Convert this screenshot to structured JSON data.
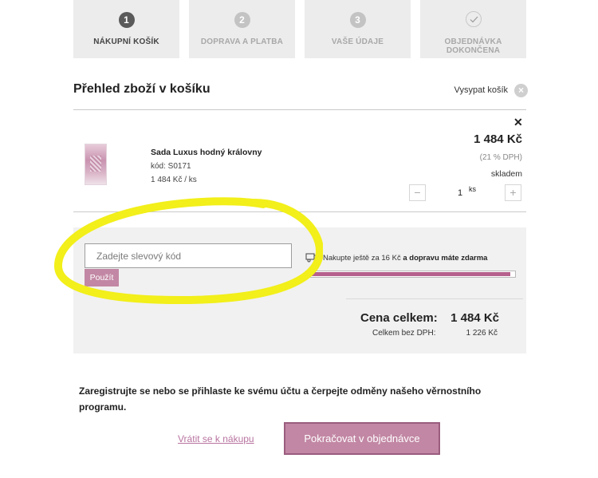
{
  "steps": [
    {
      "number": "1",
      "label": "NÁKUPNÍ KOŠÍK"
    },
    {
      "number": "2",
      "label": "DOPRAVA A PLATBA"
    },
    {
      "number": "3",
      "label": "VAŠE ÚDAJE"
    },
    {
      "label": "OBJEDNÁVKA DOKONČENA"
    }
  ],
  "cart": {
    "title": "Přehled zboží v košíku",
    "empty_label": "Vysypat košík"
  },
  "product": {
    "name": "Sada Luxus hodný královny",
    "code": "kód: S0171",
    "unit_price": "1 484 Kč / ks",
    "price": "1 484 Kč",
    "vat": "(21 % DPH)",
    "stock": "skladem",
    "quantity": "1",
    "unit": "ks"
  },
  "coupon": {
    "placeholder": "Zadejte slevový kód",
    "apply_label": "Použít"
  },
  "shipping": {
    "text_prefix": "Nakupte ještě za 16 Kč",
    "text_bold": "a dopravu máte zdarma",
    "progress": 0.98
  },
  "totals": {
    "total_label": "Cena celkem:",
    "total_value": "1 484 Kč",
    "no_vat_label": "Celkem bez DPH:",
    "no_vat_value": "1 226 Kč"
  },
  "loyalty_text": "Zaregistrujte se nebo se přihlaste ke svému účtu a čerpejte odměny našeho věrnostního programu.",
  "actions": {
    "back_label": "Vrátit se k nákupu",
    "continue_label": "Pokračovat v objednávce"
  },
  "colors": {
    "accent": "#c287a4",
    "progress_fill": "#b6608d",
    "highlight": "#f2ef1a"
  }
}
